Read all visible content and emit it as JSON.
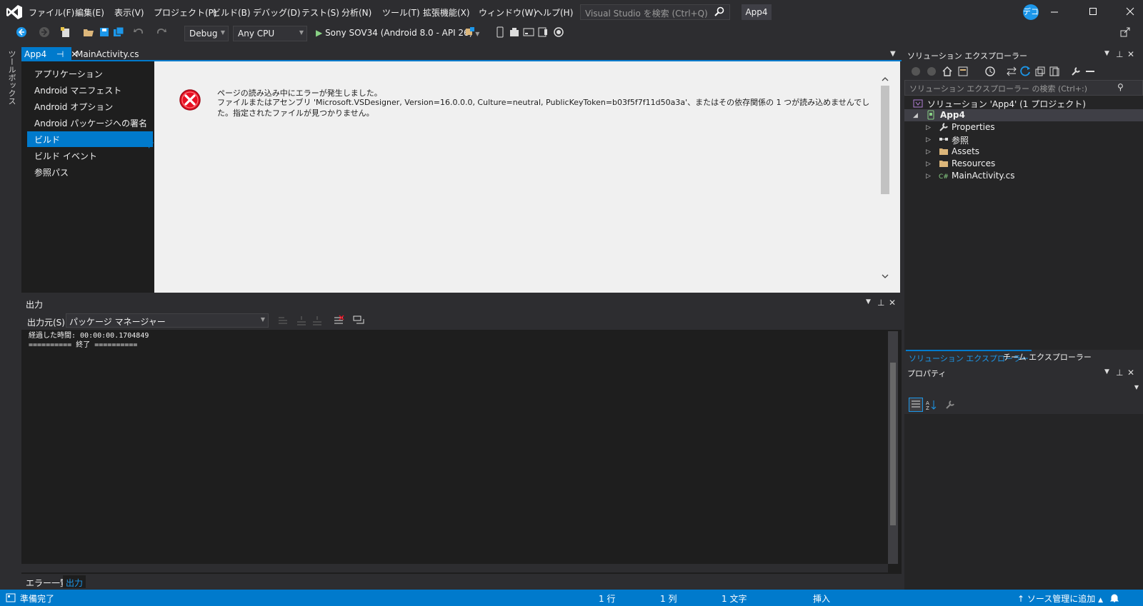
{
  "menu": {
    "items": [
      "ファイル(F)",
      "編集(E)",
      "表示(V)",
      "プロジェクト(P)",
      "ビルド(B)",
      "デバッグ(D)",
      "テスト(S)",
      "分析(N)",
      "ツール(T)",
      "拡張機能(X)",
      "ウィンドウ(W)",
      "ヘルプ(H)"
    ],
    "search_placeholder": "Visual Studio を検索 (Ctrl+Q)",
    "project_name": "App4",
    "user_initials": "デコ"
  },
  "toolbar": {
    "configuration": "Debug",
    "platform": "Any CPU",
    "run_target": "Sony SOV34 (Android 8.0 - API 26)"
  },
  "toolbox": {
    "label": "ツールボックス"
  },
  "tabs": [
    {
      "label": "App4",
      "pin": "⊣",
      "close": "✕"
    },
    {
      "label": "MainActivity.cs"
    }
  ],
  "project_nav": {
    "items": [
      "アプリケーション",
      "Android マニフェスト",
      "Android オプション",
      "Android パッケージへの署名",
      "ビルド",
      "ビルド イベント",
      "参照パス"
    ],
    "selected_index": 4
  },
  "error": {
    "title": "ページの読み込み中にエラーが発生しました。",
    "detail": "ファイルまたはアセンブリ 'Microsoft.VSDesigner, Version=16.0.0.0, Culture=neutral, PublicKeyToken=b03f5f7f11d50a3a'、またはその依存関係の 1 つが読み込めませんでした。指定されたファイルが見つかりません。"
  },
  "output": {
    "title": "出力",
    "source_label": "出力元(S):",
    "source_value": "パッケージ マネージャー",
    "lines": [
      "経過した時間: 00:00:00.1704849",
      "========== 終了 =========="
    ]
  },
  "bottom_tabs": [
    "エラー一覧",
    "出力"
  ],
  "solution_explorer": {
    "title": "ソリューション エクスプローラー",
    "search_placeholder": "ソリューション エクスプローラー の検索 (Ctrl+:)",
    "solution_label": "ソリューション 'App4' (1 プロジェクト)",
    "project": "App4",
    "children": [
      "Properties",
      "参照",
      "Assets",
      "Resources",
      "MainActivity.cs"
    ],
    "tabs": [
      "ソリューション エクスプローラー",
      "チーム エクスプローラー"
    ]
  },
  "properties": {
    "title": "プロパティ"
  },
  "status": {
    "ready": "準備完了",
    "line": "1 行",
    "col": "1 列",
    "chars": "1 文字",
    "mode": "挿入",
    "source_control": "ソース管理に追加"
  },
  "colors": {
    "accent": "#007acc",
    "background": "#2d2d30",
    "editor": "#1e1e1e",
    "error_red": "#e81123"
  }
}
